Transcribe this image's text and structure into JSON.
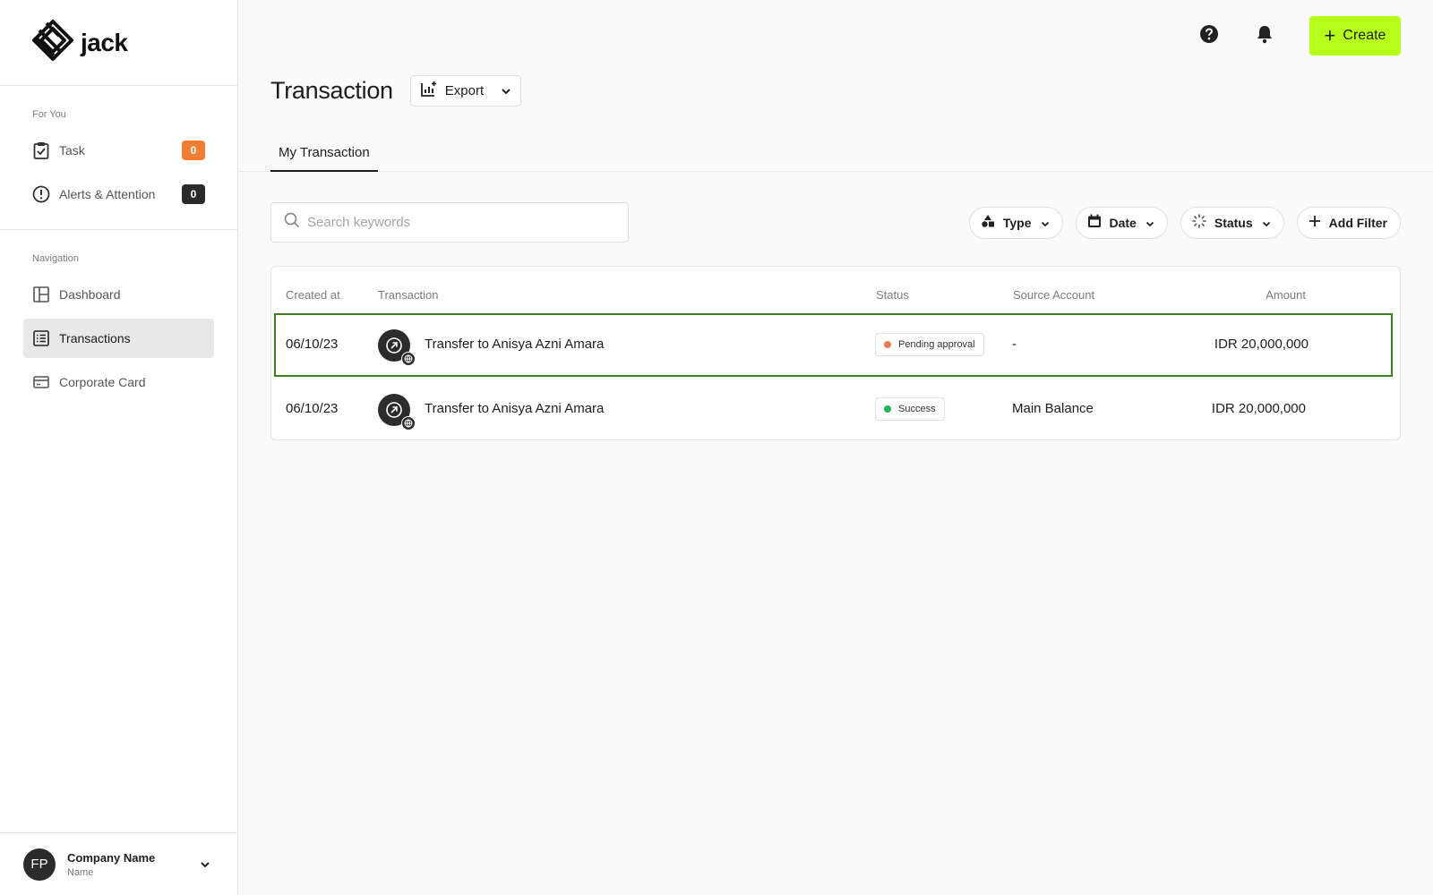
{
  "brand": {
    "name": "jack"
  },
  "sidebar": {
    "for_you_label": "For You",
    "for_you": [
      {
        "label": "Task",
        "badge": "0",
        "icon": "clipboard-check-icon",
        "badge_color": "#f07e33"
      },
      {
        "label": "Alerts & Attention",
        "badge": "0",
        "icon": "alert-circle-icon",
        "badge_color": "#2b2b2b"
      }
    ],
    "navigation_label": "Navigation",
    "navigation": [
      {
        "label": "Dashboard",
        "icon": "layout-icon",
        "active": false
      },
      {
        "label": "Transactions",
        "icon": "list-icon",
        "active": true
      },
      {
        "label": "Corporate Card",
        "icon": "credit-card-icon",
        "active": false
      }
    ]
  },
  "user": {
    "initials": "FP",
    "company": "Company Name",
    "sub": "Name"
  },
  "header": {
    "create_label": "Create",
    "accent_color": "#b5ff1a"
  },
  "page": {
    "title": "Transaction",
    "export_label": "Export"
  },
  "tabs": [
    {
      "label": "My Transaction",
      "active": true
    }
  ],
  "search": {
    "placeholder": "Search keywords",
    "value": ""
  },
  "filters": [
    {
      "label": "Type",
      "icon": "shapes-icon"
    },
    {
      "label": "Date",
      "icon": "calendar-icon"
    },
    {
      "label": "Status",
      "icon": "loader-icon"
    }
  ],
  "add_filter_label": "Add Filter",
  "table": {
    "columns": [
      "Created at",
      "Transaction",
      "Status",
      "Source Account",
      "Amount"
    ],
    "rows": [
      {
        "created_at": "06/10/23",
        "transaction": "Transfer to Anisya Azni Amara",
        "status": "Pending approval",
        "status_color": "#f07a5a",
        "source": "-",
        "amount": "IDR 20,000,000",
        "selected": true
      },
      {
        "created_at": "06/10/23",
        "transaction": "Transfer to Anisya Azni Amara",
        "status": "Success",
        "status_color": "#1fb35a",
        "source": "Main Balance",
        "amount": "IDR 20,000,000",
        "selected": false
      }
    ]
  }
}
